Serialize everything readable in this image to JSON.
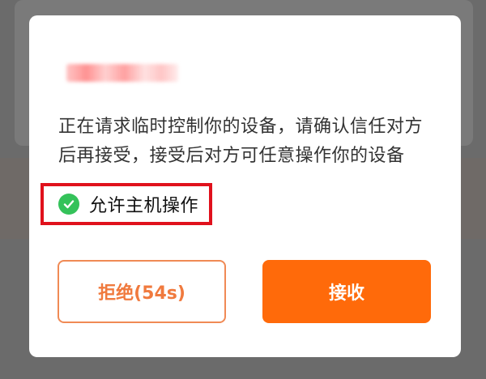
{
  "dialog": {
    "message_line1": "正在请求临时控制你的设备，请确认信任对方",
    "message_line2": "后再接受，接受后对方可任意操作你的设备",
    "permission": {
      "label": "允许主机操作",
      "checked": true,
      "icon": "check-circle-icon"
    },
    "reject_label": "拒绝(54s)",
    "accept_label": "接收"
  },
  "colors": {
    "accent": "#ff6a0a",
    "reject_text": "#f07a3e",
    "check": "#34c25a",
    "highlight": "#e0111c"
  }
}
